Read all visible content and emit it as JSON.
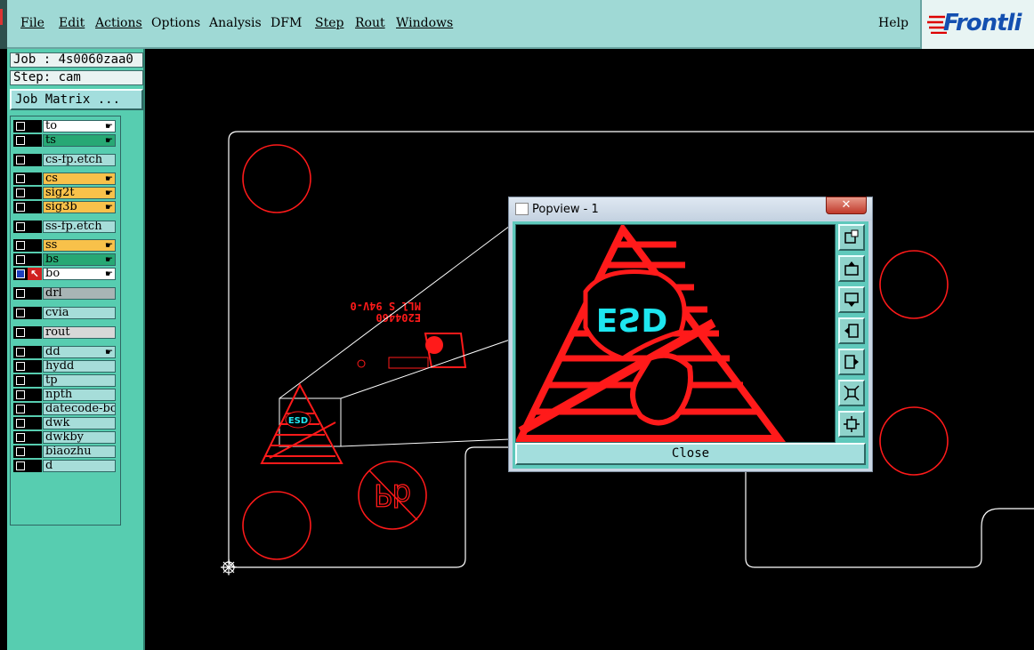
{
  "menubar": {
    "items": [
      {
        "label": "File",
        "underline": true
      },
      {
        "label": "Edit",
        "underline": true
      },
      {
        "label": "Actions",
        "underline": true
      },
      {
        "label": "Options",
        "underline": false
      },
      {
        "label": "Analysis",
        "underline": false
      },
      {
        "label": "DFM",
        "underline": false
      },
      {
        "label": "Step",
        "underline": true
      },
      {
        "label": "Rout",
        "underline": true
      },
      {
        "label": "Windows",
        "underline": true
      }
    ],
    "help_label": "Help",
    "brand_text": "Frontli"
  },
  "sidebar": {
    "job": "Job : 4s0060zaa0",
    "step": "Step: cam",
    "job_matrix_label": "Job Matrix ...",
    "layers": [
      {
        "name": "to",
        "color": "#ffffff",
        "hand": true
      },
      {
        "name": "ts",
        "color": "#27a874",
        "hand": true
      },
      {
        "name": "cs-fp.etch",
        "color": "#a6ddd9",
        "hand": false
      },
      {
        "name": "cs",
        "color": "#f8c14a",
        "hand": true
      },
      {
        "name": "sig2t",
        "color": "#f8c14a",
        "hand": true
      },
      {
        "name": "sig3b",
        "color": "#f8c14a",
        "hand": true
      },
      {
        "name": "ss-fp.etch",
        "color": "#a6ddd9",
        "hand": false
      },
      {
        "name": "ss",
        "color": "#f8c14a",
        "hand": true
      },
      {
        "name": "bs",
        "color": "#27a874",
        "hand": true
      },
      {
        "name": "bo",
        "color": "#ffffff",
        "hand": true,
        "active": true
      },
      {
        "name": "drl",
        "color": "#a8b5b5",
        "hand": false
      },
      {
        "name": "cvia",
        "color": "#a6ddd9",
        "hand": false
      },
      {
        "name": "rout",
        "color": "#d8d8d8",
        "hand": false
      },
      {
        "name": "dd",
        "color": "#a6ddd9",
        "hand": true
      },
      {
        "name": "hydd",
        "color": "#a6ddd9",
        "hand": false
      },
      {
        "name": "tp",
        "color": "#a6ddd9",
        "hand": false
      },
      {
        "name": "npth",
        "color": "#a6ddd9",
        "hand": false
      },
      {
        "name": "datecode-bo",
        "color": "#a6ddd9",
        "hand": false
      },
      {
        "name": "dwk",
        "color": "#a6ddd9",
        "hand": false
      },
      {
        "name": "dwkby",
        "color": "#a6ddd9",
        "hand": false
      },
      {
        "name": "biaozhu",
        "color": "#a6ddd9",
        "hand": false
      },
      {
        "name": "d",
        "color": "#a6ddd9",
        "hand": false
      }
    ]
  },
  "canvas": {
    "silkscreen_text": [
      "E204460",
      "MLl S 94V-0"
    ],
    "esd_text": "ESD",
    "pb_text": "Pb"
  },
  "popview": {
    "title": "Popview - 1",
    "close_x": "✕",
    "close_label": "Close",
    "esd_text": "ESD",
    "tools": [
      "zoom-fit-icon",
      "pan-up-icon",
      "pan-down-icon",
      "pan-left-icon",
      "pan-right-icon",
      "zoom-in-icon",
      "zoom-out-icon"
    ]
  },
  "colors": {
    "menubar_bg": "#9fd9d5",
    "sidebar_bg": "#57cdb0",
    "artwork_red": "#ff1a1a",
    "esd_cyan": "#1ee6f0",
    "outline_white": "#ffffff"
  }
}
